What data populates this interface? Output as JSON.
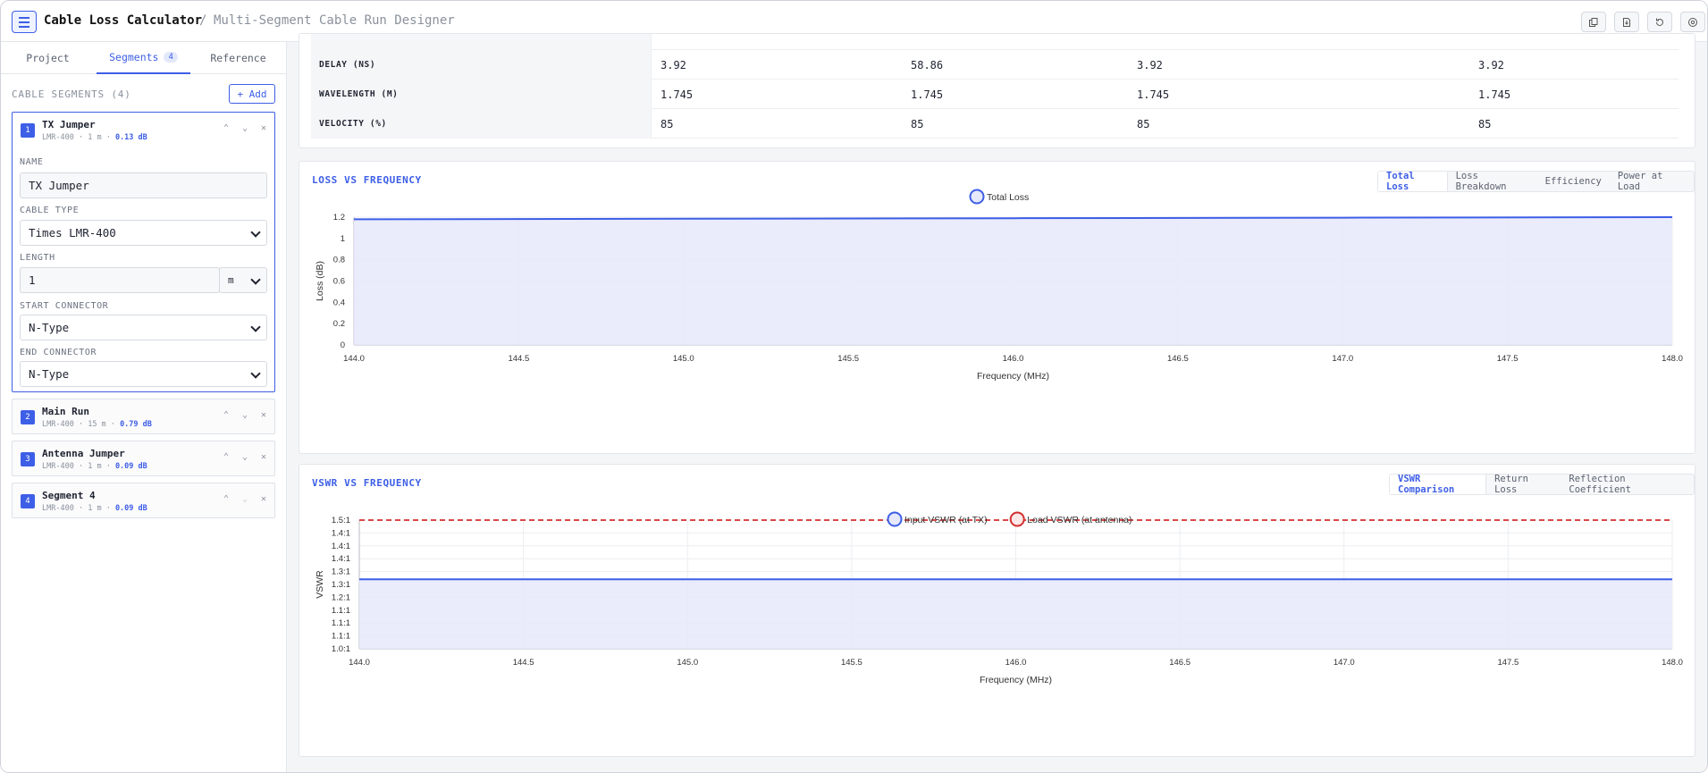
{
  "header": {
    "title": "Cable Loss Calculator",
    "separator": "/",
    "subtitle": "Multi-Segment Cable Run Designer",
    "toolbar_icons": [
      "copy-icon",
      "export-icon",
      "reset-icon",
      "help-icon"
    ]
  },
  "sidebar": {
    "tabs": [
      {
        "label": "Project"
      },
      {
        "label": "Segments",
        "count": "4"
      },
      {
        "label": "Reference"
      }
    ],
    "segments_heading": "CABLE SEGMENTS",
    "segments_count": "(4)",
    "add_label": "+ Add",
    "segments": [
      {
        "num": "1",
        "name": "TX Jumper",
        "cable": "LMR-400",
        "length": "1 m",
        "loss": "0.13 dB"
      },
      {
        "num": "2",
        "name": "Main Run",
        "cable": "LMR-400",
        "length": "15 m",
        "loss": "0.79 dB"
      },
      {
        "num": "3",
        "name": "Antenna Jumper",
        "cable": "LMR-400",
        "length": "1 m",
        "loss": "0.09 dB"
      },
      {
        "num": "4",
        "name": "Segment 4",
        "cable": "LMR-400",
        "length": "1 m",
        "loss": "0.09 dB"
      }
    ],
    "meta_sep": "·",
    "editor": {
      "name_label": "NAME",
      "name_value": "TX Jumper",
      "cable_label": "CABLE TYPE",
      "cable_value": "Times LMR-400",
      "length_label": "LENGTH",
      "length_value": "1",
      "length_unit": "m",
      "start_label": "START CONNECTOR",
      "start_value": "N-Type",
      "end_label": "END CONNECTOR",
      "end_value": "N-Type"
    }
  },
  "table": {
    "rows": [
      {
        "label": "DELAY (NS)",
        "values": [
          "3.92",
          "58.86",
          "3.92",
          "3.92"
        ]
      },
      {
        "label": "WAVELENGTH (M)",
        "values": [
          "1.745",
          "1.745",
          "1.745",
          "1.745"
        ]
      },
      {
        "label": "VELOCITY (%)",
        "values": [
          "85",
          "85",
          "85",
          "85"
        ]
      }
    ]
  },
  "loss_card": {
    "title": "LOSS VS FREQUENCY",
    "tabs": [
      "Total Loss",
      "Loss Breakdown",
      "Efficiency",
      "Power at Load"
    ]
  },
  "vswr_card": {
    "title": "VSWR VS FREQUENCY",
    "tabs": [
      "VSWR Comparison",
      "Return Loss",
      "Reflection Coefficient"
    ]
  },
  "colors": {
    "accent": "#3d5ee6",
    "red": "#d32f2f",
    "fill": "#e6e9fb"
  },
  "chart_data": [
    {
      "type": "area",
      "xlabel": "Frequency (MHz)",
      "ylabel": "Loss (dB)",
      "x_ticks": [
        "144.0",
        "144.5",
        "145.0",
        "145.5",
        "146.0",
        "146.5",
        "147.0",
        "147.5",
        "148.0"
      ],
      "y_ticks": [
        "0",
        "0.2",
        "0.4",
        "0.6",
        "0.8",
        "1",
        "1.2"
      ],
      "xlim": [
        144,
        148
      ],
      "ylim": [
        0,
        1.2
      ],
      "legend_placement": "top-center",
      "grid": true,
      "series": [
        {
          "name": "Total Loss",
          "color": "#3d5ee6",
          "x": [
            144,
            145,
            146,
            147,
            148
          ],
          "y": [
            1.18,
            1.185,
            1.19,
            1.195,
            1.2
          ]
        }
      ]
    },
    {
      "type": "line",
      "xlabel": "Frequency (MHz)",
      "ylabel": "VSWR",
      "y_tick_labels": [
        "1.0:1",
        "1.1:1",
        "1.1:1",
        "1.1:1",
        "1.2:1",
        "1.3:1",
        "1.3:1",
        "1.4:1",
        "1.4:1",
        "1.4:1",
        "1.5:1"
      ],
      "x_ticks": [
        "144.0",
        "144.5",
        "145.0",
        "145.5",
        "146.0",
        "146.5",
        "147.0",
        "147.5",
        "148.0"
      ],
      "xlim": [
        144,
        148
      ],
      "ylim": [
        1.0,
        1.5
      ],
      "legend_placement": "top-center",
      "grid": true,
      "series": [
        {
          "name": "Input VSWR (at TX)",
          "color": "#3d5ee6",
          "x": [
            144,
            146,
            148
          ],
          "y": [
            1.27,
            1.27,
            1.27
          ]
        },
        {
          "name": "Load VSWR (at antenna)",
          "color": "#d32f2f",
          "dashed": true,
          "x": [
            144,
            146,
            148
          ],
          "y": [
            1.5,
            1.5,
            1.5
          ]
        }
      ]
    }
  ]
}
